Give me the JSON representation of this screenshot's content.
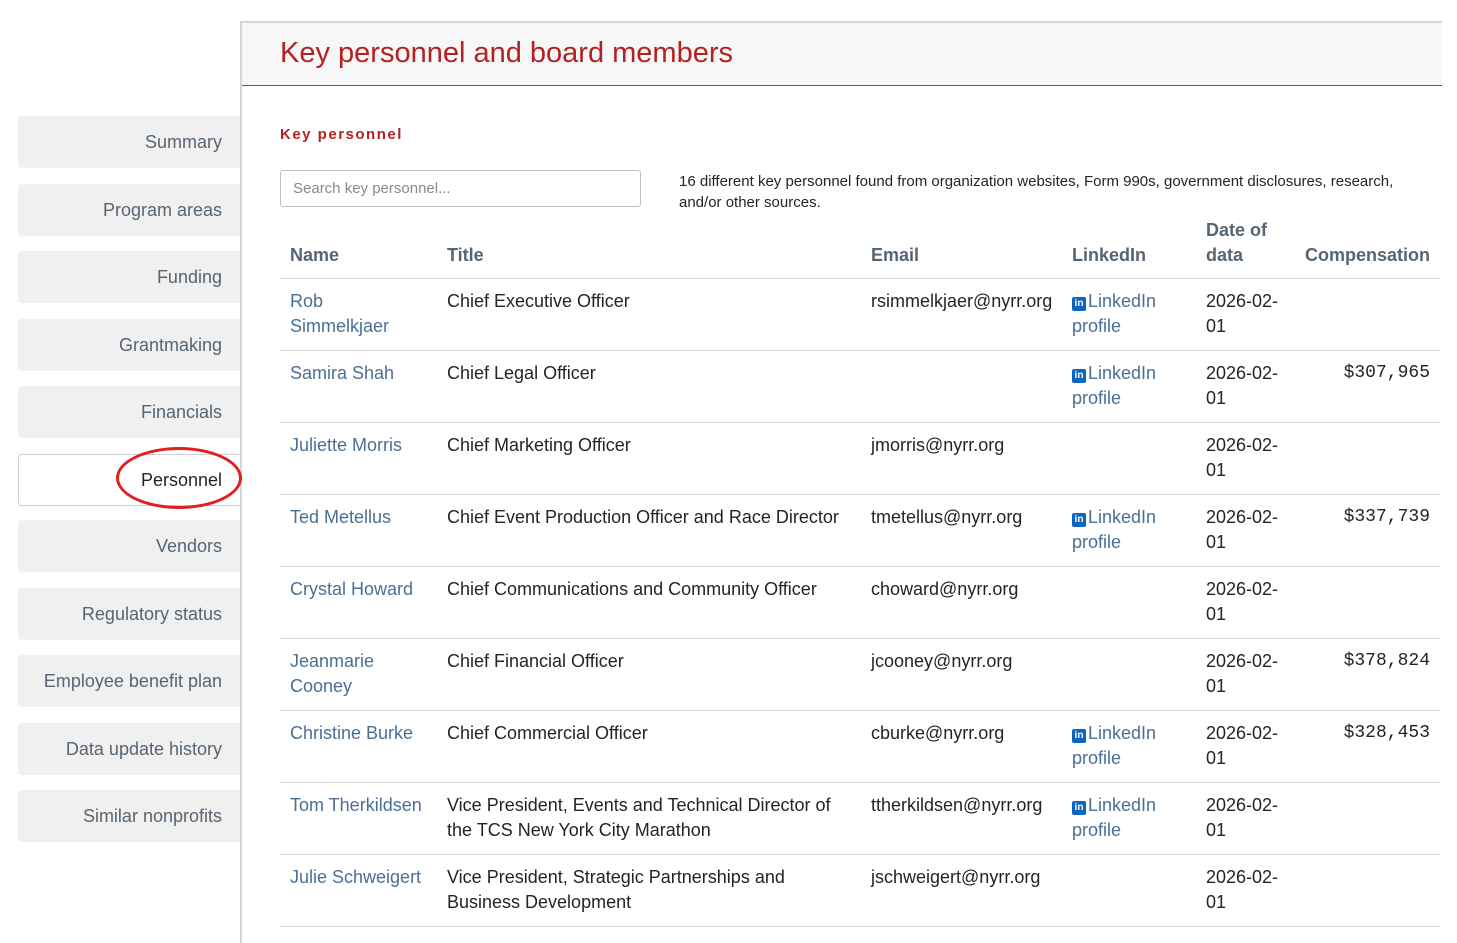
{
  "sidebar": {
    "items": [
      {
        "label": "Summary"
      },
      {
        "label": "Program areas"
      },
      {
        "label": "Funding"
      },
      {
        "label": "Grantmaking"
      },
      {
        "label": "Financials"
      },
      {
        "label": "Personnel",
        "active": true
      },
      {
        "label": "Vendors"
      },
      {
        "label": "Regulatory status"
      },
      {
        "label": "Employee benefit plan"
      },
      {
        "label": "Data update history"
      },
      {
        "label": "Similar nonprofits"
      }
    ]
  },
  "header": {
    "title": "Key personnel and board members"
  },
  "section": {
    "label": "Key personnel",
    "search_placeholder": "Search key personnel...",
    "found_text": "16 different key personnel found from organization websites, Form 990s, government disclosures, research, and/or other sources."
  },
  "table": {
    "columns": {
      "name": "Name",
      "title": "Title",
      "email": "Email",
      "linkedin": "LinkedIn",
      "date": "Date of data",
      "compensation": "Compensation"
    },
    "linkedin_label": "LinkedIn profile",
    "rows": [
      {
        "name": "Rob Simmelkjaer",
        "title": "Chief Executive Officer",
        "email": "rsimmelkjaer@nyrr.org",
        "linkedin": true,
        "date": "2026-02-01",
        "compensation": ""
      },
      {
        "name": "Samira Shah",
        "title": "Chief Legal Officer",
        "email": "",
        "linkedin": true,
        "date": "2026-02-01",
        "compensation": "$307,965"
      },
      {
        "name": "Juliette Morris",
        "title": "Chief Marketing Officer",
        "email": "jmorris@nyrr.org",
        "linkedin": false,
        "date": "2026-02-01",
        "compensation": ""
      },
      {
        "name": "Ted Metellus",
        "title": "Chief Event Production Officer and Race Director",
        "email": "tmetellus@nyrr.org",
        "linkedin": true,
        "date": "2026-02-01",
        "compensation": "$337,739"
      },
      {
        "name": "Crystal Howard",
        "title": "Chief Communications and Community Officer",
        "email": "choward@nyrr.org",
        "linkedin": false,
        "date": "2026-02-01",
        "compensation": ""
      },
      {
        "name": "Jeanmarie Cooney",
        "title": "Chief Financial Officer",
        "email": "jcooney@nyrr.org",
        "linkedin": false,
        "date": "2026-02-01",
        "compensation": "$378,824"
      },
      {
        "name": "Christine Burke",
        "title": "Chief Commercial Officer",
        "email": "cburke@nyrr.org",
        "linkedin": true,
        "date": "2026-02-01",
        "compensation": "$328,453"
      },
      {
        "name": "Tom Therkildsen",
        "title": "Vice President, Events and Technical Director of the TCS New York City Marathon",
        "email": "ttherkildsen@nyrr.org",
        "linkedin": true,
        "date": "2026-02-01",
        "compensation": ""
      },
      {
        "name": "Julie Schweigert",
        "title": "Vice President, Strategic Partnerships and Business Development",
        "email": "jschweigert@nyrr.org",
        "linkedin": false,
        "date": "2026-02-01",
        "compensation": ""
      }
    ]
  },
  "colors": {
    "accent": "#b22222",
    "link": "#4a6f96",
    "linkedin": "#0a66c2",
    "highlight_circle": "#e02020"
  }
}
